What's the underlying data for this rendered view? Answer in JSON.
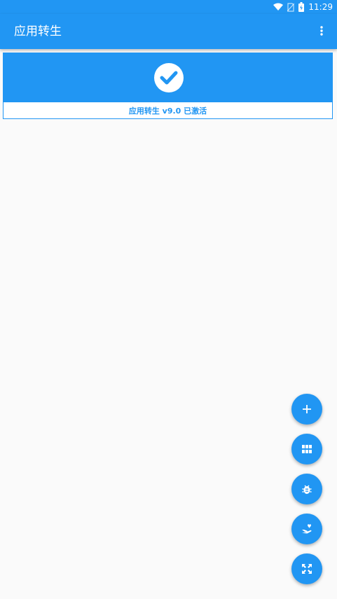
{
  "status_bar": {
    "time": "11:29",
    "icons": [
      "wifi-icon",
      "no-sim-icon",
      "battery-charging-icon"
    ]
  },
  "app_bar": {
    "title": "应用转生",
    "menu_icon": "more-vert-icon"
  },
  "activation_card": {
    "icon": "check-circle-icon",
    "status_text": "应用转生 v9.0 已激活"
  },
  "fab_menu": [
    {
      "icon": "add-icon"
    },
    {
      "icon": "apps-grid-icon"
    },
    {
      "icon": "bug-icon"
    },
    {
      "icon": "donate-hand-heart-icon"
    },
    {
      "icon": "fullscreen-expand-icon"
    }
  ],
  "colors": {
    "primary": "#2196f3",
    "background": "#fafafa",
    "on_primary": "#ffffff"
  }
}
